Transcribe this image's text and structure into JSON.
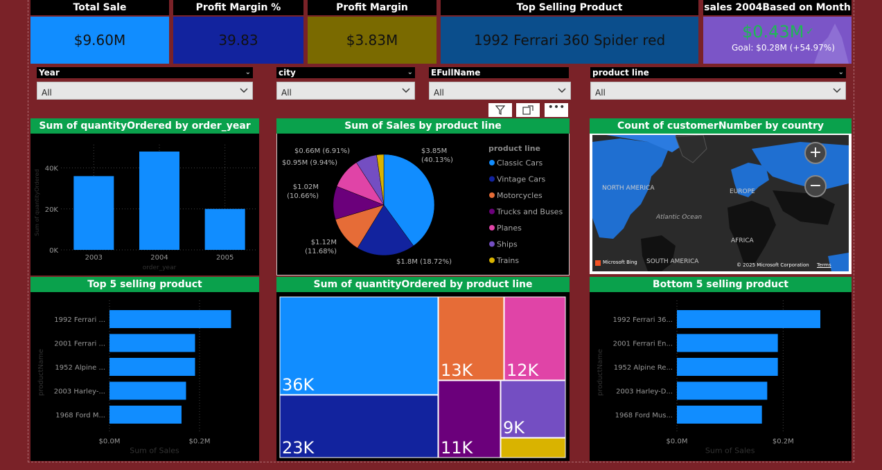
{
  "kpis": [
    {
      "title": "Total Sale",
      "value": "$9.60M",
      "color": "#118dff"
    },
    {
      "title": "Profit Margin %",
      "value": "39.83",
      "color": "#12239e"
    },
    {
      "title": "Profit Margin",
      "value": "$3.83M",
      "color": "#7a6a00"
    },
    {
      "title": "Top Selling Product",
      "value": "1992 Ferrari 360 Spider red",
      "color": "#0b4e8c"
    },
    {
      "title": "sales 2004Based on Month",
      "value": "$0.43M",
      "goal": "Goal: $0.28M (+54.97%)",
      "color": "#7b55c7"
    }
  ],
  "slicers": [
    {
      "label": "Year",
      "value": "All"
    },
    {
      "label": "city",
      "value": "All"
    },
    {
      "label": "EFullName",
      "value": "All"
    },
    {
      "label": "product line",
      "value": "All"
    }
  ],
  "visual_titles": {
    "qty_by_year": "Sum of quantityOrdered by order_year",
    "sales_by_line": "Sum of Sales by product line",
    "customers_by_country": "Count of customerNumber by country",
    "top5": "Top 5 selling product",
    "qty_by_line": "Sum of quantityOrdered by product line",
    "bottom5": "Bottom 5 selling product"
  },
  "map": {
    "labels": [
      "NORTH AMERICA",
      "EUROPE",
      "Atlantic Ocean",
      "AFRICA",
      "SOUTH AMERICA"
    ],
    "brand": "Microsoft Bing",
    "copyright": "© 2025 Microsoft Corporation",
    "terms": "Terms"
  },
  "chart_data": [
    {
      "type": "bar",
      "categories": [
        "2003",
        "2004",
        "2005"
      ],
      "values": [
        36000,
        48000,
        20000
      ],
      "xlabel": "order_year",
      "ylabel": "Sum of quantityOrdered",
      "yticks": [
        "0K",
        "20K",
        "40K"
      ],
      "ylim": [
        0,
        50000
      ],
      "color": "#118dff"
    },
    {
      "type": "pie",
      "legend_title": "product line",
      "slices": [
        {
          "name": "Classic Cars",
          "value": 3.85,
          "label": "$3.85M (40.13%)",
          "color": "#118dff"
        },
        {
          "name": "Vintage Cars",
          "value": 1.8,
          "label": "$1.8M (18.72%)",
          "color": "#12239e"
        },
        {
          "name": "Motorcycles",
          "value": 1.12,
          "label": "$1.12M (11.68%)",
          "color": "#e66c37"
        },
        {
          "name": "Trucks and Buses",
          "value": 1.02,
          "label": "$1.02M (10.66%)",
          "color": "#6b007b"
        },
        {
          "name": "Planes",
          "value": 0.95,
          "label": "$0.95M (9.94%)",
          "color": "#e044a7"
        },
        {
          "name": "Ships",
          "value": 0.66,
          "label": "$0.66M (6.91%)",
          "color": "#744ec2"
        },
        {
          "name": "Trains",
          "value": 0.22,
          "label": "",
          "color": "#d9b300"
        }
      ]
    },
    {
      "type": "bar",
      "orientation": "horizontal",
      "categories": [
        "1992 Ferrari ...",
        "2001 Ferrari ...",
        "1952 Alpine ...",
        "2003 Harley-...",
        "1968 Ford M..."
      ],
      "values": [
        0.27,
        0.19,
        0.19,
        0.17,
        0.16
      ],
      "xlabel": "Sum of Sales",
      "ylabel": "productName",
      "xticks": [
        "$0.0M",
        "$0.2M"
      ],
      "xlim": [
        0,
        0.3
      ],
      "color": "#118dff"
    },
    {
      "type": "treemap",
      "cells": [
        {
          "name": "Classic Cars",
          "label": "36K",
          "color": "#118dff"
        },
        {
          "name": "Vintage Cars",
          "label": "23K",
          "color": "#12239e"
        },
        {
          "name": "Motorcycles",
          "label": "13K",
          "color": "#e66c37"
        },
        {
          "name": "Planes",
          "label": "12K",
          "color": "#e044a7"
        },
        {
          "name": "Trucks and Buses",
          "label": "11K",
          "color": "#6b007b"
        },
        {
          "name": "Ships",
          "label": "9K",
          "color": "#744ec2"
        },
        {
          "name": "Trains",
          "label": "",
          "color": "#d9b300"
        }
      ]
    },
    {
      "type": "bar",
      "orientation": "horizontal",
      "categories": [
        "1992 Ferrari 36...",
        "2001 Ferrari En...",
        "1952 Alpine Re...",
        "2003 Harley-D...",
        "1968 Ford Mus..."
      ],
      "values": [
        0.27,
        0.19,
        0.19,
        0.17,
        0.16
      ],
      "xlabel": "Sum of Sales",
      "ylabel": "productName",
      "xticks": [
        "$0.0M",
        "$0.2M"
      ],
      "xlim": [
        0,
        0.3
      ],
      "color": "#118dff"
    }
  ]
}
